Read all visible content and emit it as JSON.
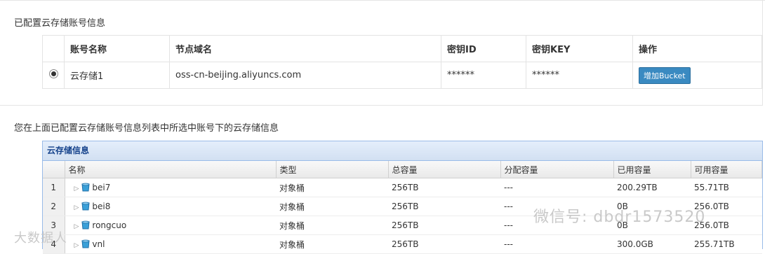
{
  "section1": {
    "title": "已配置云存储账号信息",
    "headers": [
      "账号名称",
      "节点域名",
      "密钥ID",
      "密钥KEY",
      "操作"
    ],
    "row": {
      "name": "云存储1",
      "domain": "oss-cn-beijing.aliyuncs.com",
      "key_id": "******",
      "key_secret": "******",
      "action_label": "增加Bucket"
    }
  },
  "section2": {
    "title": "您在上面已配置云存储账号信息列表中所选中账号下的云存储信息",
    "panel_title": "云存储信息",
    "headers": [
      "名称",
      "类型",
      "总容量",
      "分配容量",
      "已用容量",
      "可用容量"
    ],
    "rows": [
      {
        "num": "1",
        "name": "bei7",
        "type": "对象桶",
        "total": "256TB",
        "alloc": "---",
        "used": "200.29TB",
        "avail": "55.71TB"
      },
      {
        "num": "2",
        "name": "bei8",
        "type": "对象桶",
        "total": "256TB",
        "alloc": "---",
        "used": "0B",
        "avail": "256.0TB"
      },
      {
        "num": "3",
        "name": "rongcuo",
        "type": "对象桶",
        "total": "256TB",
        "alloc": "---",
        "used": "0B",
        "avail": "256.0TB"
      },
      {
        "num": "4",
        "name": "vnl",
        "type": "对象桶",
        "total": "256TB",
        "alloc": "---",
        "used": "300.0GB",
        "avail": "255.71TB"
      }
    ]
  },
  "watermarks": {
    "wechat": "微信号: dbdr1573520",
    "brand": "大数据人"
  },
  "colors": {
    "button": "#3a8ac1",
    "panel_border": "#99bbe8",
    "panel_title": "#15428b"
  }
}
